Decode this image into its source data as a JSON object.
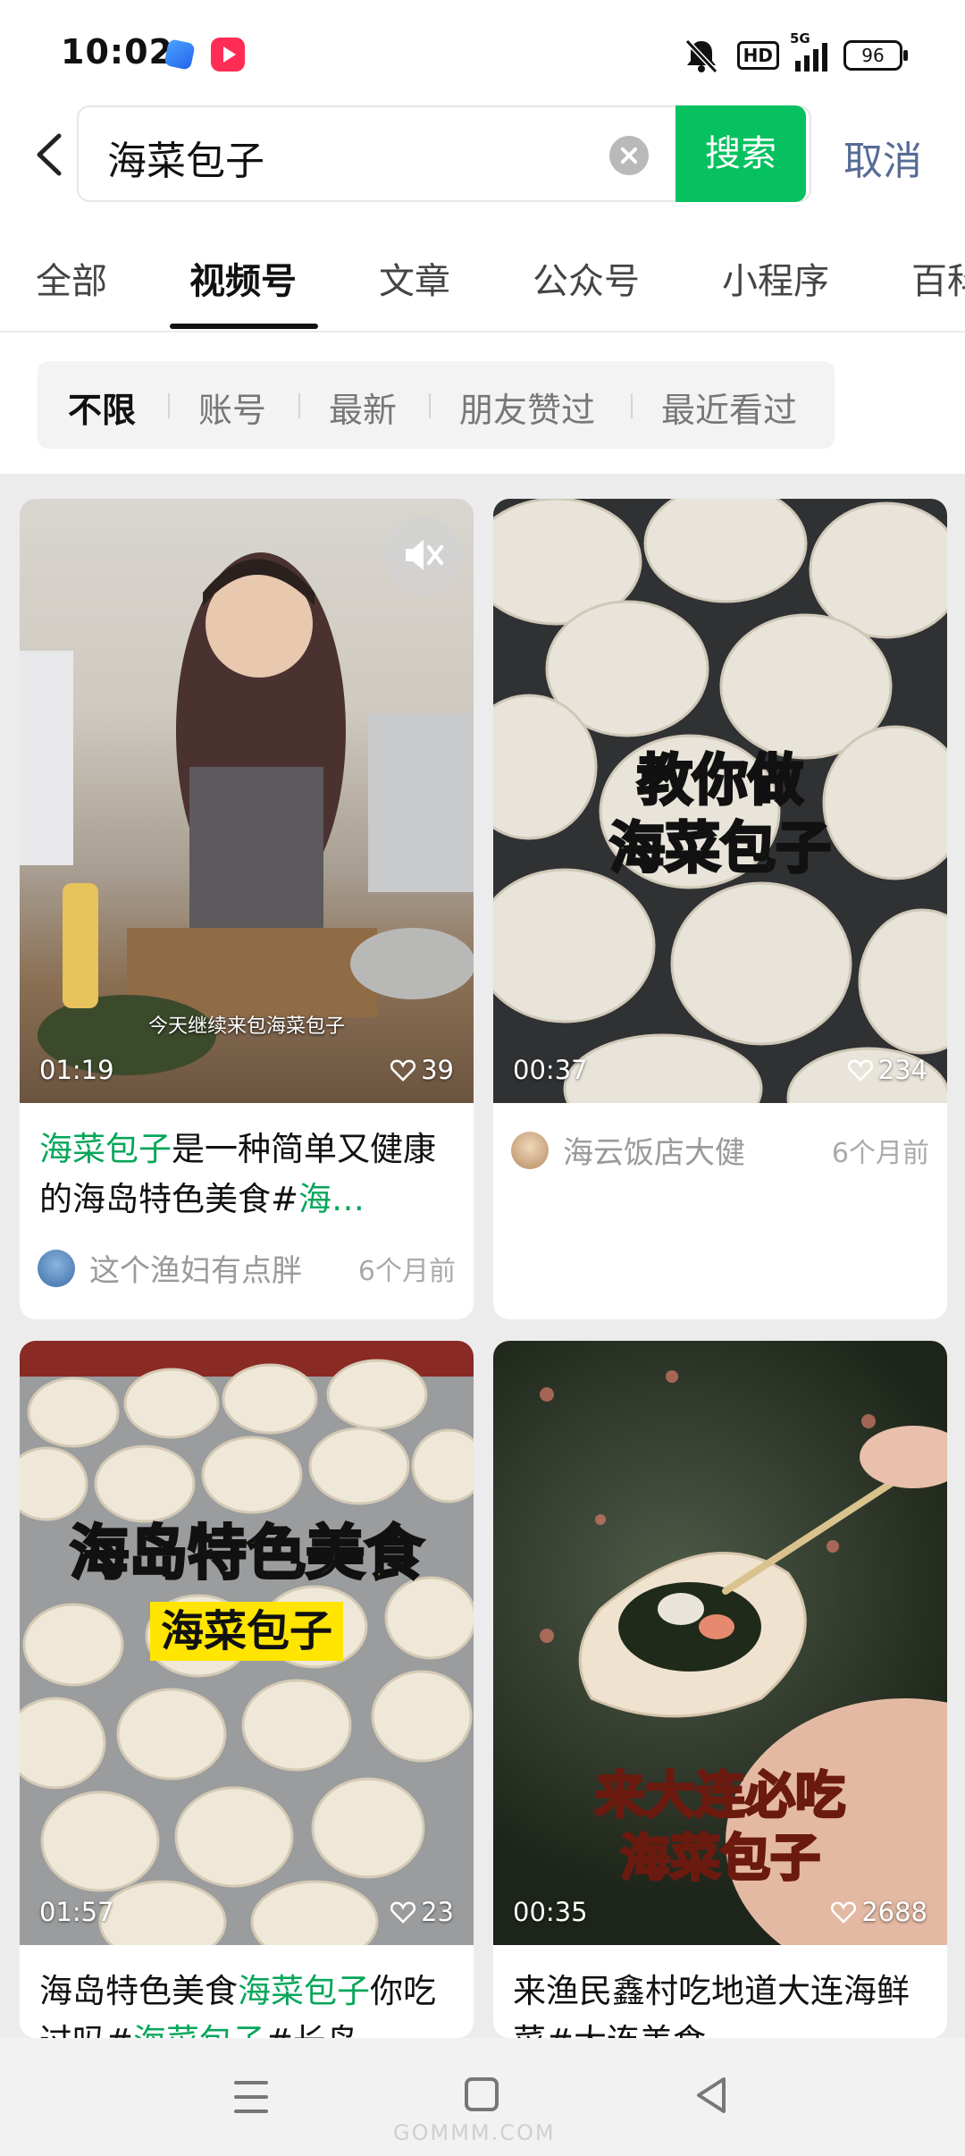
{
  "status_bar": {
    "time": "10:02",
    "network": "5G",
    "hd_badge": "HD",
    "battery": "96",
    "icons": [
      "mute-bell-icon",
      "hd-icon",
      "signal-icon",
      "battery-icon"
    ]
  },
  "search": {
    "back_icon": "chevron-left-icon",
    "query": "海菜包子",
    "clear_icon": "clear-circle-icon",
    "search_label": "搜索",
    "cancel_label": "取消",
    "accent": "#07c160"
  },
  "tabs": [
    {
      "label": "全部",
      "active": false
    },
    {
      "label": "视频号",
      "active": true
    },
    {
      "label": "文章",
      "active": false
    },
    {
      "label": "公众号",
      "active": false
    },
    {
      "label": "小程序",
      "active": false
    },
    {
      "label": "百科",
      "active": false
    }
  ],
  "filters": [
    {
      "label": "不限",
      "active": true
    },
    {
      "label": "账号",
      "active": false
    },
    {
      "label": "最新",
      "active": false
    },
    {
      "label": "朋友赞过",
      "active": false
    },
    {
      "label": "最近看过",
      "active": false
    }
  ],
  "videos": [
    {
      "duration": "01:19",
      "likes": "39",
      "caption_overlay": "今天继续来包海菜包子",
      "title_parts": [
        {
          "text": "海菜包子",
          "hl": true
        },
        {
          "text": "是一种简单又健康的海岛特色美食#",
          "hl": false
        },
        {
          "text": "海…",
          "hl": true
        }
      ],
      "author": "这个渔妇有点胖",
      "ago": "6个月前",
      "muted_icon": "mute-speaker-icon"
    },
    {
      "duration": "00:37",
      "likes": "234",
      "overlay_line1": "教你做",
      "overlay_line2": "海菜包子",
      "author": "海云饭店大健",
      "ago": "6个月前"
    },
    {
      "duration": "01:57",
      "likes": "23",
      "overlay_line1": "海岛特色美食",
      "overlay_line2": "海菜包子",
      "title_parts": [
        {
          "text": "海岛特色美食",
          "hl": false
        },
        {
          "text": "海菜包子",
          "hl": true
        },
        {
          "text": "你吃过吗#",
          "hl": false
        },
        {
          "text": "海菜包子",
          "hl": true
        },
        {
          "text": "#长岛",
          "hl": false
        }
      ]
    },
    {
      "duration": "00:35",
      "likes": "2688",
      "overlay_line1": "来大连必吃",
      "overlay_line2": "海菜包子",
      "title_parts": [
        {
          "text": "来渔民鑫村吃地道大连海鲜菜#大连美食",
          "hl": false
        }
      ]
    }
  ],
  "nav": {
    "icons": [
      "menu-icon",
      "home-square-icon",
      "back-triangle-icon"
    ],
    "watermark": "GOMMM.COM"
  }
}
